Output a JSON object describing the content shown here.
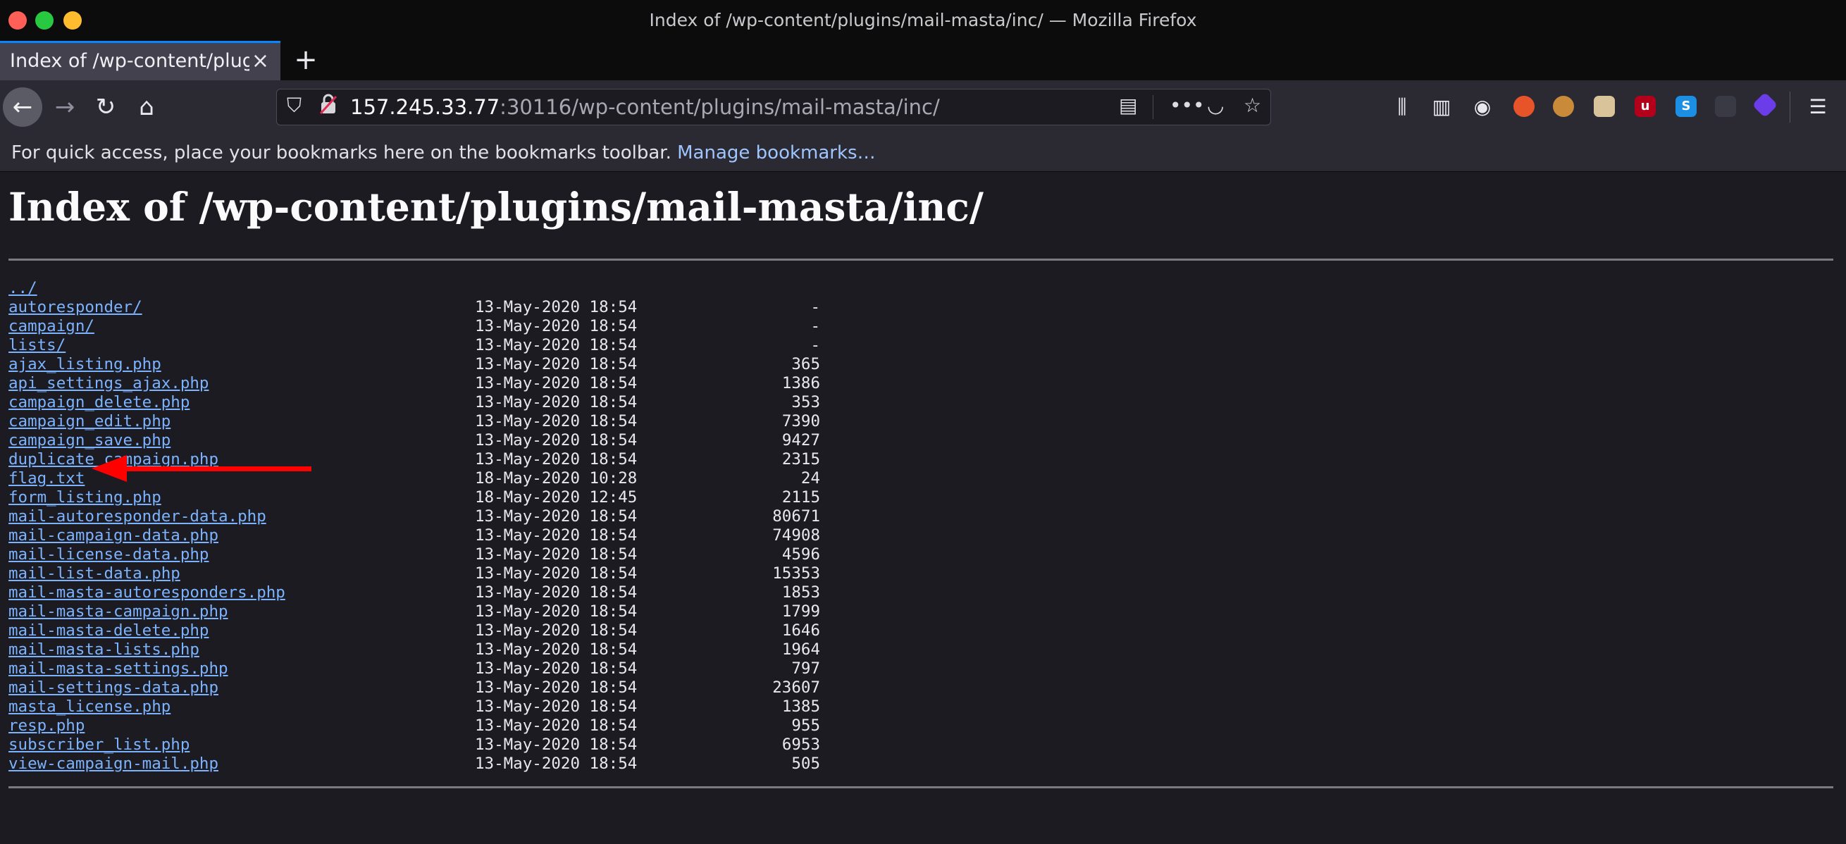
{
  "window": {
    "title": "Index of /wp-content/plugins/mail-masta/inc/ — Mozilla Firefox"
  },
  "tab": {
    "label": "Index of /wp-content/plugins/mail-masta/inc/",
    "close_icon": "×",
    "new_tab_icon": "+"
  },
  "nav": {
    "url_host": "157.245.33.77",
    "url_rest": ":30116/wp-content/plugins/mail-masta/inc/",
    "icons": {
      "back": "←",
      "forward": "→",
      "reload": "↻",
      "home": "⌂",
      "shield": "⛉",
      "reader": "▤",
      "more": "•••",
      "pocket": "◡",
      "star": "☆",
      "library": "⫼",
      "sidebar": "▥",
      "account": "◉",
      "menu": "☰"
    }
  },
  "bookmarks": {
    "text": "For quick access, place your bookmarks here on the bookmarks toolbar.",
    "link": "Manage bookmarks…"
  },
  "page": {
    "title": "Index of /wp-content/plugins/mail-masta/inc/",
    "entries": [
      {
        "name": "../",
        "date": "",
        "size": ""
      },
      {
        "name": "autoresponder/",
        "date": "13-May-2020 18:54",
        "size": "-"
      },
      {
        "name": "campaign/",
        "date": "13-May-2020 18:54",
        "size": "-"
      },
      {
        "name": "lists/",
        "date": "13-May-2020 18:54",
        "size": "-"
      },
      {
        "name": "ajax_listing.php",
        "date": "13-May-2020 18:54",
        "size": "365"
      },
      {
        "name": "api_settings_ajax.php",
        "date": "13-May-2020 18:54",
        "size": "1386"
      },
      {
        "name": "campaign_delete.php",
        "date": "13-May-2020 18:54",
        "size": "353"
      },
      {
        "name": "campaign_edit.php",
        "date": "13-May-2020 18:54",
        "size": "7390"
      },
      {
        "name": "campaign_save.php",
        "date": "13-May-2020 18:54",
        "size": "9427"
      },
      {
        "name": "duplicate_campaign.php",
        "date": "13-May-2020 18:54",
        "size": "2315"
      },
      {
        "name": "flag.txt",
        "date": "18-May-2020 10:28",
        "size": "24"
      },
      {
        "name": "form_listing.php",
        "date": "18-May-2020 12:45",
        "size": "2115"
      },
      {
        "name": "mail-autoresponder-data.php",
        "date": "13-May-2020 18:54",
        "size": "80671"
      },
      {
        "name": "mail-campaign-data.php",
        "date": "13-May-2020 18:54",
        "size": "74908"
      },
      {
        "name": "mail-license-data.php",
        "date": "13-May-2020 18:54",
        "size": "4596"
      },
      {
        "name": "mail-list-data.php",
        "date": "13-May-2020 18:54",
        "size": "15353"
      },
      {
        "name": "mail-masta-autoresponders.php",
        "date": "13-May-2020 18:54",
        "size": "1853"
      },
      {
        "name": "mail-masta-campaign.php",
        "date": "13-May-2020 18:54",
        "size": "1799"
      },
      {
        "name": "mail-masta-delete.php",
        "date": "13-May-2020 18:54",
        "size": "1646"
      },
      {
        "name": "mail-masta-lists.php",
        "date": "13-May-2020 18:54",
        "size": "1964"
      },
      {
        "name": "mail-masta-settings.php",
        "date": "13-May-2020 18:54",
        "size": "797"
      },
      {
        "name": "mail-settings-data.php",
        "date": "13-May-2020 18:54",
        "size": "23607"
      },
      {
        "name": "masta_license.php",
        "date": "13-May-2020 18:54",
        "size": "1385"
      },
      {
        "name": "resp.php",
        "date": "13-May-2020 18:54",
        "size": "955"
      },
      {
        "name": "subscriber_list.php",
        "date": "13-May-2020 18:54",
        "size": "6953"
      },
      {
        "name": "view-campaign-mail.php",
        "date": "13-May-2020 18:54",
        "size": "505"
      }
    ]
  },
  "colors": {
    "link": "#7bb3ff",
    "annotation_arrow": "#ff0000",
    "tab_accent": "#0a84ff"
  }
}
